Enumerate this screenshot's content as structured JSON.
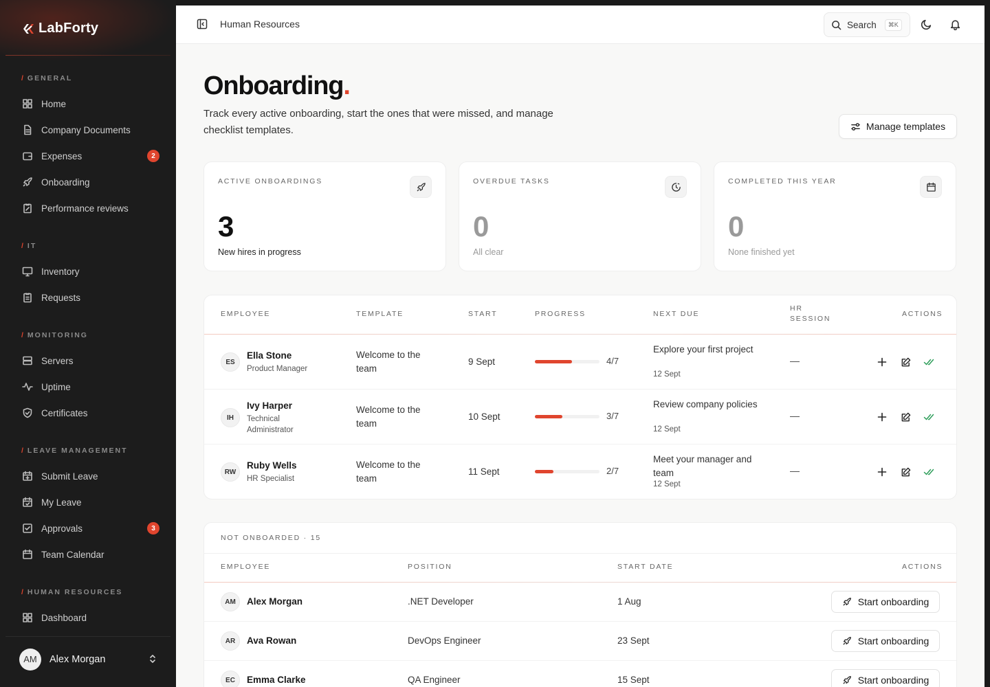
{
  "app": {
    "name": "LabForty"
  },
  "sidebar": {
    "sections": {
      "general": "GENERAL",
      "it": "IT",
      "monitoring": "MONITORING",
      "leave": "LEAVE MANAGEMENT",
      "hr": "HUMAN RESOURCES"
    },
    "items": {
      "home": "Home",
      "company_documents": "Company Documents",
      "expenses": "Expenses",
      "expenses_badge": "2",
      "onboarding": "Onboarding",
      "performance_reviews": "Performance reviews",
      "inventory": "Inventory",
      "requests": "Requests",
      "servers": "Servers",
      "uptime": "Uptime",
      "certificates": "Certificates",
      "submit_leave": "Submit Leave",
      "my_leave": "My Leave",
      "approvals": "Approvals",
      "approvals_badge": "3",
      "team_calendar": "Team Calendar",
      "dashboard": "Dashboard"
    },
    "user": {
      "initials": "AM",
      "name": "Alex Morgan"
    }
  },
  "header": {
    "breadcrumb": "Human Resources",
    "search_label": "Search",
    "search_shortcut": "⌘K"
  },
  "page": {
    "title": "Onboarding",
    "title_dot": ".",
    "subtitle": "Track every active onboarding, start the ones that were missed, and manage checklist templates.",
    "manage_templates": "Manage templates"
  },
  "stats": [
    {
      "label": "ACTIVE ONBOARDINGS",
      "value": "3",
      "note": "New hires in progress",
      "icon": "rocket-icon"
    },
    {
      "label": "OVERDUE TASKS",
      "value": "0",
      "note": "All clear",
      "icon": "clock-icon"
    },
    {
      "label": "COMPLETED THIS YEAR",
      "value": "0",
      "note": "None finished yet",
      "icon": "calendar-icon"
    }
  ],
  "active_table": {
    "headers": {
      "employee": "EMPLOYEE",
      "template": "TEMPLATE",
      "start": "START",
      "progress": "PROGRESS",
      "next_due": "NEXT DUE",
      "hr_session_1": "HR",
      "hr_session_2": "SESSION",
      "actions": "ACTIONS"
    },
    "rows": [
      {
        "initials": "ES",
        "name": "Ella Stone",
        "role": "Product Manager",
        "template": "Welcome to the team",
        "start": "9 Sept",
        "progress_done": 4,
        "progress_total": 7,
        "progress_text": "4/7",
        "due_title": "Explore your first project",
        "due_date": "12 Sept",
        "hr_session": "—"
      },
      {
        "initials": "IH",
        "name": "Ivy Harper",
        "role": "Technical Administrator",
        "template": "Welcome to the team",
        "start": "10 Sept",
        "progress_done": 3,
        "progress_total": 7,
        "progress_text": "3/7",
        "due_title": "Review company policies",
        "due_date": "12 Sept",
        "hr_session": "—"
      },
      {
        "initials": "RW",
        "name": "Ruby Wells",
        "role": "HR Specialist",
        "template": "Welcome to the team",
        "start": "11 Sept",
        "progress_done": 2,
        "progress_total": 7,
        "progress_text": "2/7",
        "due_title": "Meet your manager and team",
        "due_date": "12 Sept",
        "hr_session": "—"
      }
    ]
  },
  "not_onboarded": {
    "title": "NOT ONBOARDED · 15",
    "headers": {
      "employee": "EMPLOYEE",
      "position": "POSITION",
      "start_date": "START DATE",
      "actions": "ACTIONS"
    },
    "button_label": "Start onboarding",
    "rows": [
      {
        "initials": "AM",
        "name": "Alex Morgan",
        "position": ".NET Developer",
        "start_date": "1 Aug"
      },
      {
        "initials": "AR",
        "name": "Ava Rowan",
        "position": "DevOps Engineer",
        "start_date": "23 Sept"
      },
      {
        "initials": "EC",
        "name": "Emma Clarke",
        "position": "QA Engineer",
        "start_date": "15 Sept"
      }
    ]
  },
  "colors": {
    "accent": "#e0452e",
    "sidebar_bg": "#1c1c1c",
    "success": "#2f9e5b"
  }
}
